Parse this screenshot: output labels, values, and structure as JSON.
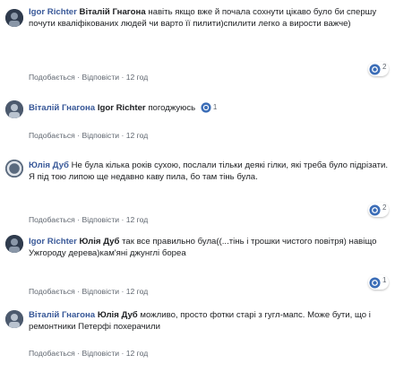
{
  "comments": [
    {
      "author": "Igor Richter",
      "mention": "Віталій Гнагона",
      "text": " навіть якщо вже й почала сохнути цікаво було би спершу почути кваліфікованих людей чи варто її пилити)спилити легко а вирости важче)",
      "actions": {
        "like": "Подобається",
        "reply": "Відповісти",
        "time": "12 год"
      },
      "reactions": {
        "count": "2"
      }
    },
    {
      "author": "Віталій Гнагона",
      "mention": "Igor Richter",
      "text": " погоджуюсь",
      "actions": {
        "like": "Подобається",
        "reply": "Відповісти",
        "time": "12 год"
      },
      "reactions": {
        "count": "1"
      }
    },
    {
      "author": "Юлія Дуб",
      "mention": "",
      "text": "Не була кілька років сухою, послали тільки деякі гілки, які треба було підрізати. Я під тою липою ще недавно каву пила, бо там тінь була.",
      "actions": {
        "like": "Подобається",
        "reply": "Відповісти",
        "time": "12 год"
      },
      "reactions": {
        "count": "2"
      }
    },
    {
      "author": "Igor Richter",
      "mention": "Юлія Дуб",
      "text": " так все правильно була((...тінь і трошки чистого повітря) навіщо Ужгороду дерева)кам'яні джунглі бореа",
      "actions": {
        "like": "Подобається",
        "reply": "Відповісти",
        "time": "12 год"
      },
      "reactions": {
        "count": "1"
      }
    },
    {
      "author": "Віталій Гнагона",
      "mention": "Юлія Дуб",
      "text": " можливо, просто фотки старі з гугл-мапс. Може бути, що і ремонтники Петерфі похерачили",
      "actions": {
        "like": "Подобається",
        "reply": "Відповісти",
        "time": "12 год"
      }
    }
  ]
}
